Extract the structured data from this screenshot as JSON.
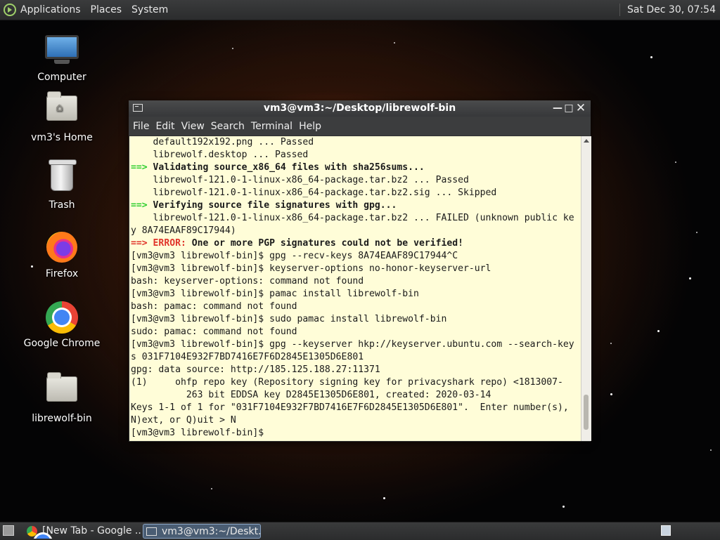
{
  "top_panel": {
    "menus": [
      "Applications",
      "Places",
      "System"
    ],
    "clock": "Sat Dec 30, 07:54"
  },
  "desktop_icons": [
    {
      "label": "Computer",
      "icon": "computer-icon"
    },
    {
      "label": "vm3's Home",
      "icon": "home-folder-icon"
    },
    {
      "label": "Trash",
      "icon": "trash-icon"
    },
    {
      "label": "Firefox",
      "icon": "firefox-icon"
    },
    {
      "label": "Google Chrome",
      "icon": "chrome-icon"
    },
    {
      "label": "librewolf-bin",
      "icon": "folder-icon"
    }
  ],
  "terminal": {
    "title": "vm3@vm3:~/Desktop/librewolf-bin",
    "menu": [
      "File",
      "Edit",
      "View",
      "Search",
      "Terminal",
      "Help"
    ],
    "lines": [
      "    default192x192.png ... Passed",
      "    librewolf.desktop ... Passed",
      "==> Validating source_x86_64 files with sha256sums...",
      "    librewolf-121.0-1-linux-x86_64-package.tar.bz2 ... Passed",
      "    librewolf-121.0-1-linux-x86_64-package.tar.bz2.sig ... Skipped",
      "==> Verifying source file signatures with gpg...",
      "    librewolf-121.0-1-linux-x86_64-package.tar.bz2 ... FAILED (unknown public ke",
      "y 8A74EAAF89C17944)",
      "==> ERROR: One or more PGP signatures could not be verified!",
      "[vm3@vm3 librewolf-bin]$ gpg --recv-keys 8A74EAAF89C17944^C",
      "[vm3@vm3 librewolf-bin]$ keyserver-options no-honor-keyserver-url",
      "bash: keyserver-options: command not found",
      "[vm3@vm3 librewolf-bin]$ pamac install librewolf-bin",
      "bash: pamac: command not found",
      "[vm3@vm3 librewolf-bin]$ sudo pamac install librewolf-bin",
      "sudo: pamac: command not found",
      "[vm3@vm3 librewolf-bin]$ gpg --keyserver hkp://keyserver.ubuntu.com --search-key",
      "s 031F7104E932F7BD7416E7F6D2845E1305D6E801",
      "gpg: data source: http://185.125.188.27:11371",
      "(1)     ohfp repo key (Repository signing key for privacyshark repo) <1813007-",
      "          263 bit EDDSA key D2845E1305D6E801, created: 2020-03-14",
      "Keys 1-1 of 1 for \"031F7104E932F7BD7416E7F6D2845E1305D6E801\".  Enter number(s),",
      "N)ext, or Q)uit > N",
      "[vm3@vm3 librewolf-bin]$ "
    ],
    "line_styles": [
      "plain",
      "plain",
      "step",
      "plain",
      "plain",
      "step",
      "plain",
      "plain",
      "error",
      "plain",
      "plain",
      "plain",
      "plain",
      "plain",
      "plain",
      "plain",
      "plain",
      "plain",
      "plain",
      "plain",
      "plain",
      "plain",
      "plain",
      "plain"
    ],
    "error_label": "ERROR:"
  },
  "taskbar": {
    "tasks": [
      {
        "label": "[New Tab - Google ...",
        "icon": "chrome-icon",
        "active": false
      },
      {
        "label": "vm3@vm3:~/Deskt...",
        "icon": "terminal-icon",
        "active": true
      }
    ]
  },
  "colors": {
    "terminal_bg": "#fffdd8",
    "arrow_green": "#2fcf2f",
    "error_red": "#e0342a"
  }
}
